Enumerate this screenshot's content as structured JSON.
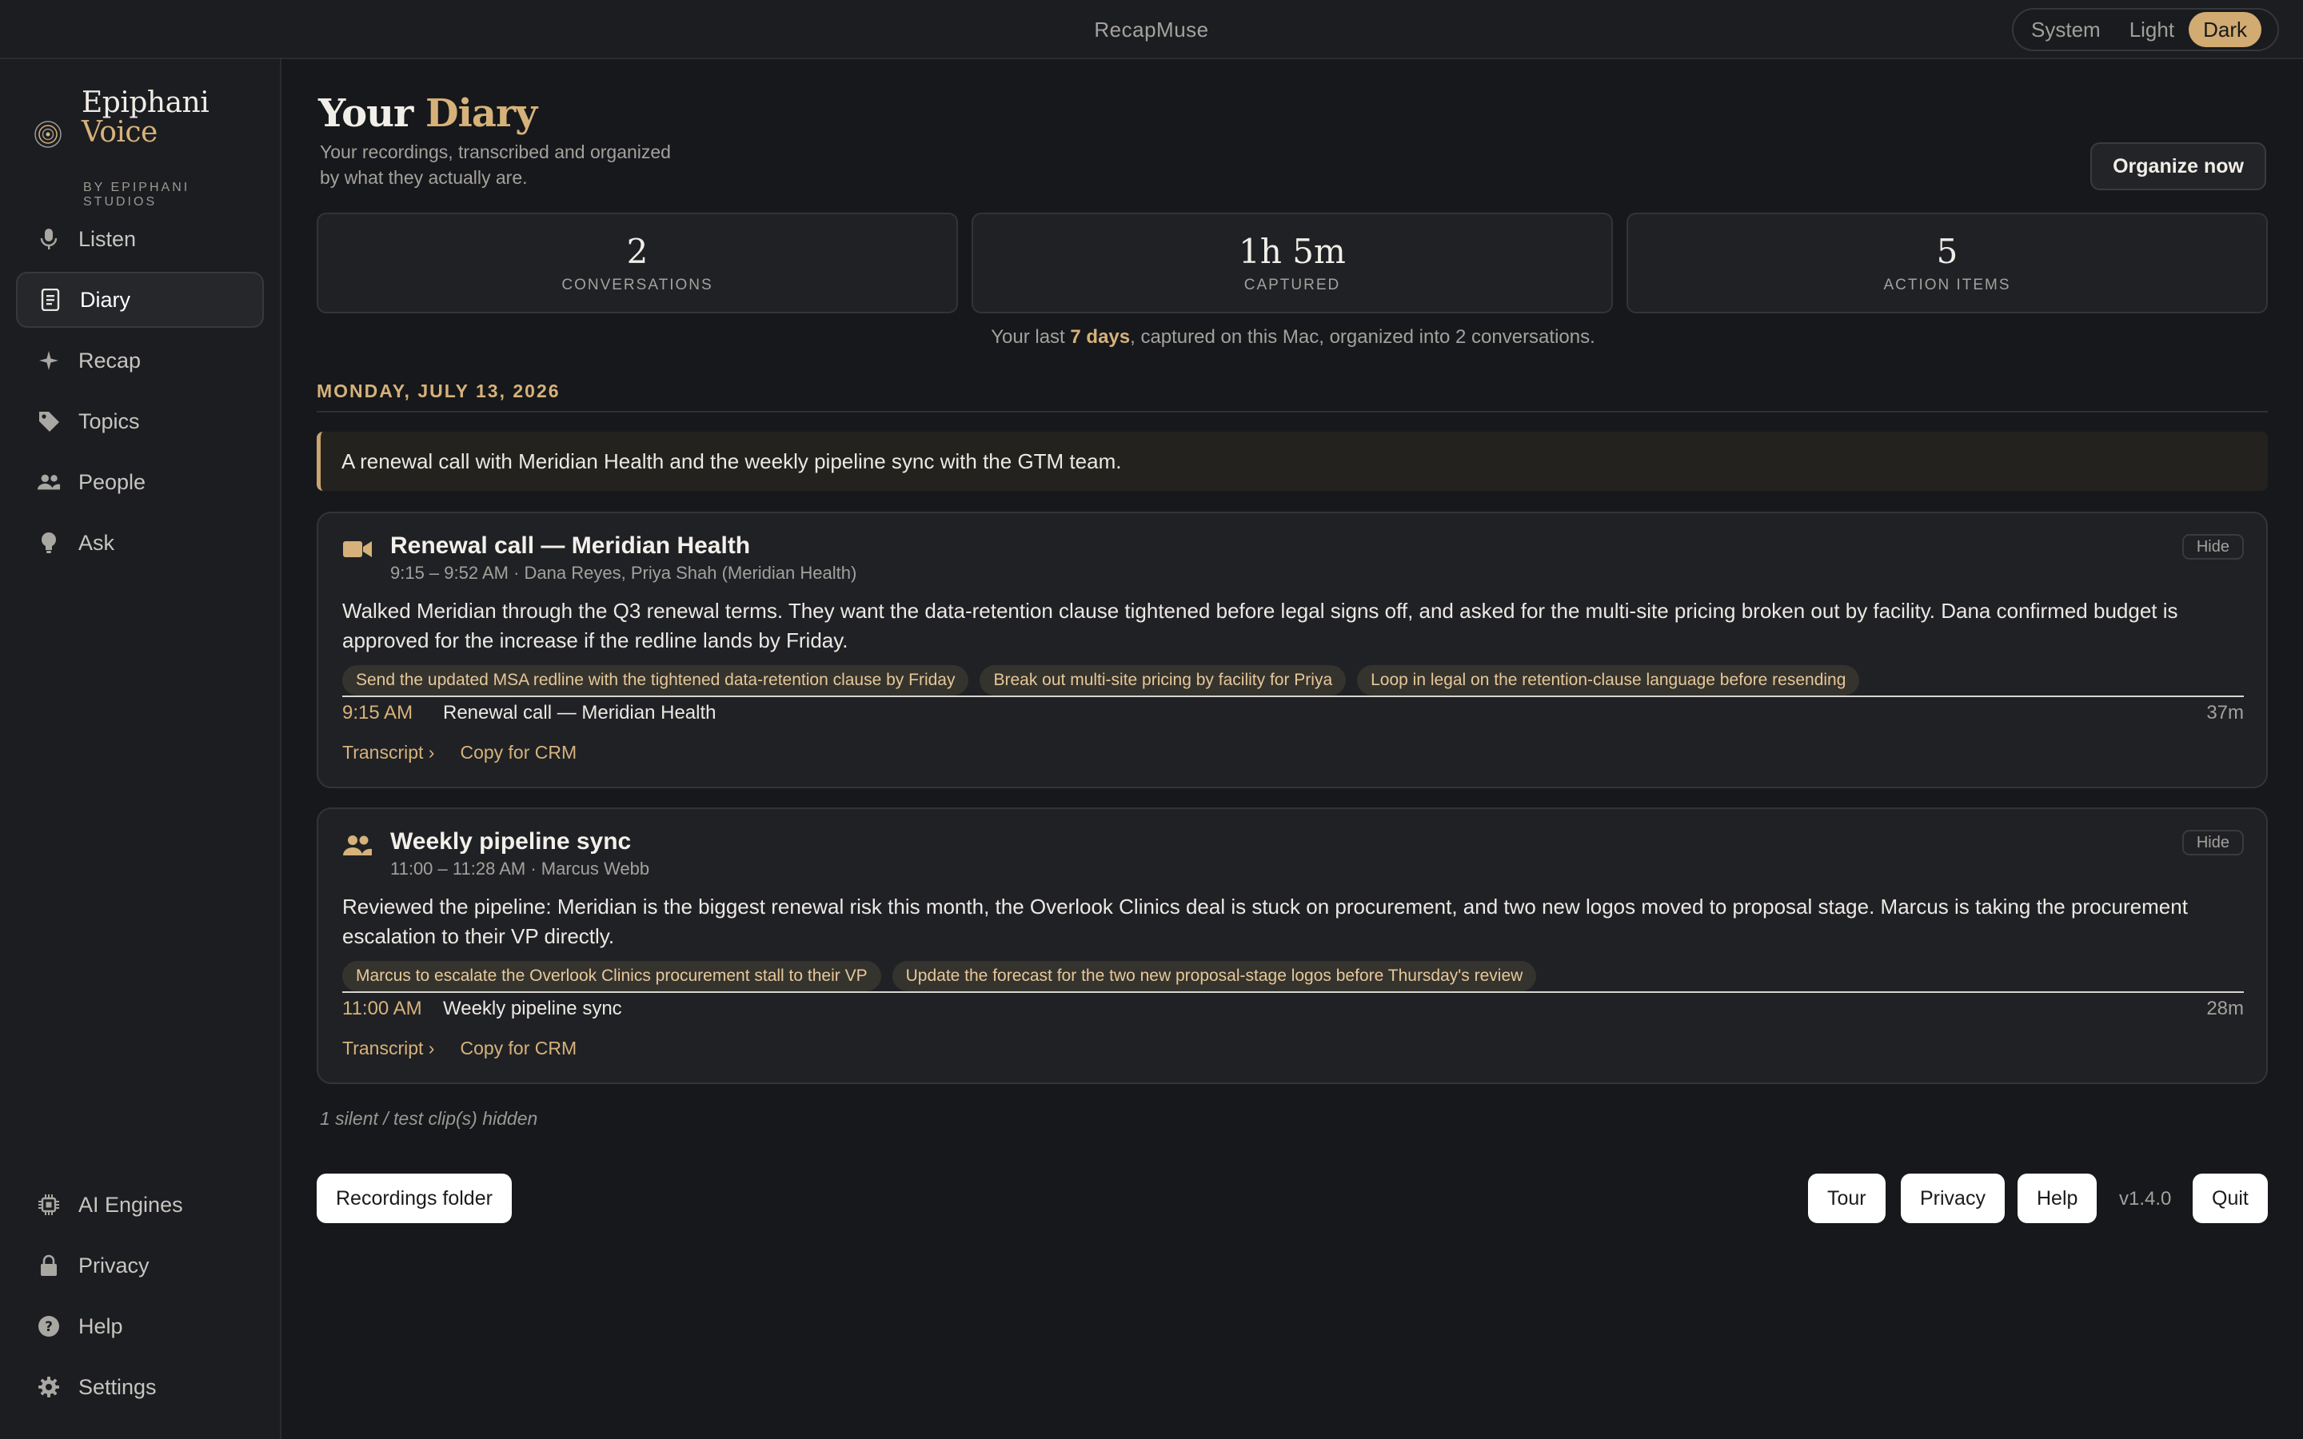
{
  "app": {
    "title": "RecapMuse"
  },
  "theme": {
    "options": [
      "System",
      "Light",
      "Dark"
    ],
    "selected": "Dark"
  },
  "brand": {
    "name_line1": "Epiphani",
    "name_line2": "Voice",
    "sub_line1": "BY EPIPHANI",
    "sub_line2": "STUDIOS"
  },
  "sidebar": {
    "items": [
      {
        "label": "Listen",
        "icon": "microphone-icon"
      },
      {
        "label": "Diary",
        "icon": "document-icon",
        "active": true
      },
      {
        "label": "Recap",
        "icon": "sparkle-icon"
      },
      {
        "label": "Topics",
        "icon": "tag-icon"
      },
      {
        "label": "People",
        "icon": "people-icon"
      },
      {
        "label": "Ask",
        "icon": "lightbulb-icon"
      }
    ],
    "bottom_items": [
      {
        "label": "AI Engines",
        "icon": "chip-icon"
      },
      {
        "label": "Privacy",
        "icon": "lock-icon"
      },
      {
        "label": "Help",
        "icon": "help-icon"
      },
      {
        "label": "Settings",
        "icon": "gear-icon"
      }
    ]
  },
  "header": {
    "title_plain": "Your",
    "title_accent": "Diary",
    "subtitle_line1": "Your recordings, transcribed and organized",
    "subtitle_line2": "by what they actually are.",
    "organize_label": "Organize now"
  },
  "stats": [
    {
      "value": "2",
      "label": "CONVERSATIONS"
    },
    {
      "value": "1h 5m",
      "label": "CAPTURED"
    },
    {
      "value": "5",
      "label": "ACTION ITEMS"
    }
  ],
  "summary": {
    "prefix": "Your last ",
    "highlight": "7 days",
    "suffix": ", captured on this Mac, organized into 2 conversations."
  },
  "day": {
    "heading": "MONDAY, JULY 13, 2026",
    "summary": "A renewal call with Meridian Health and the weekly pipeline sync with the GTM team."
  },
  "conversations": [
    {
      "icon": "video-camera-icon",
      "title": "Renewal call — Meridian Health",
      "meta": "9:15 – 9:52 AM · Dana Reyes, Priya Shah (Meridian Health)",
      "hide_label": "Hide",
      "body": "Walked Meridian through the Q3 renewal terms. They want the data-retention clause tightened before legal signs off, and asked for the multi-site pricing broken out by facility. Dana confirmed budget is approved for the increase if the redline lands by Friday.",
      "action_items": [
        "Send the updated MSA redline with the tightened data-retention clause by Friday",
        "Break out multi-site pricing by facility for Priya",
        "Loop in legal on the retention-clause language before resending"
      ],
      "segment": {
        "time": "9:15 AM",
        "name": "Renewal call — Meridian Health",
        "duration": "37m"
      },
      "transcript_label": "Transcript ›",
      "crm_label": "Copy for CRM"
    },
    {
      "icon": "people-icon",
      "title": "Weekly pipeline sync",
      "meta": "11:00 – 11:28 AM · Marcus Webb",
      "hide_label": "Hide",
      "body": "Reviewed the pipeline: Meridian is the biggest renewal risk this month, the Overlook Clinics deal is stuck on procurement, and two new logos moved to proposal stage. Marcus is taking the procurement escalation to their VP directly.",
      "action_items": [
        "Marcus to escalate the Overlook Clinics procurement stall to their VP",
        "Update the forecast for the two new proposal-stage logos before Thursday's review"
      ],
      "segment": {
        "time": "11:00 AM",
        "name": "Weekly pipeline sync",
        "duration": "28m"
      },
      "transcript_label": "Transcript ›",
      "crm_label": "Copy for CRM"
    }
  ],
  "hidden_note": "1 silent / test clip(s) hidden",
  "footer": {
    "recordings_folder": "Recordings folder",
    "tour": "Tour",
    "privacy": "Privacy",
    "help": "Help",
    "version": "v1.4.0",
    "quit": "Quit"
  },
  "colors": {
    "accent": "#d6b27a",
    "background": "#17181b",
    "card": "#202125"
  }
}
